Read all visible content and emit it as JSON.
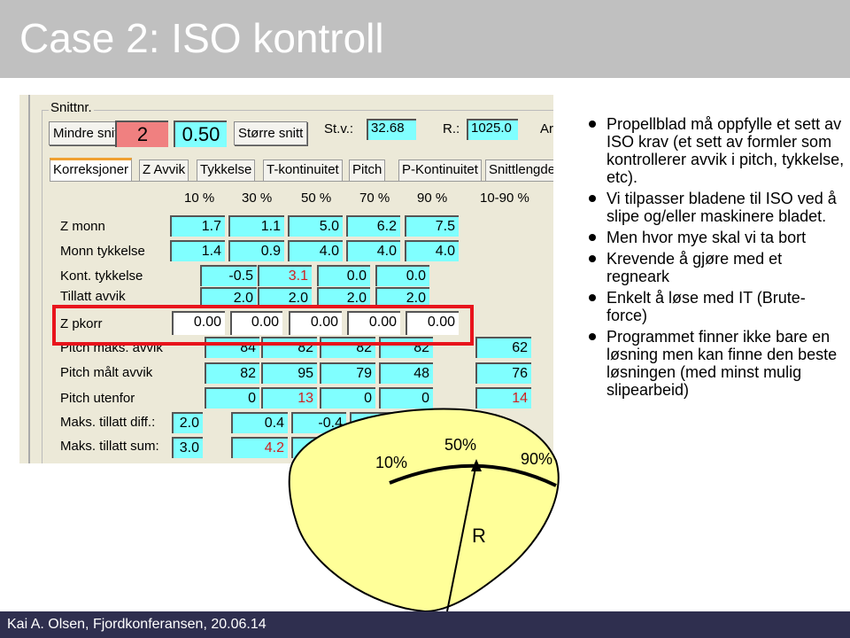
{
  "slide_title": "Case 2: ISO kontroll",
  "footer": "Kai A. Olsen, Fjordkonferansen, 20.06.14",
  "app": {
    "group_label": "Snittnr.",
    "smaller_btn": "Mindre snitt",
    "section_no": "2",
    "section_frac": "0.50",
    "larger_btn": "Større snitt",
    "stv_label": "St.v.:",
    "stv": "32.68",
    "r_label": "R.:",
    "r": "1025.0",
    "ar_label": "Arl",
    "tabs": [
      "Korreksjoner",
      "Z Avvik",
      "Tykkelse",
      "T-kontinuitet",
      "Pitch",
      "P-Kontinuitet",
      "Snittlengde"
    ],
    "columns": [
      "10 %",
      "30 %",
      "50 %",
      "70 %",
      "90 %",
      "10-90 %"
    ],
    "rows": [
      {
        "label": "Z monn",
        "values": [
          "1.7",
          "1.1",
          "5.0",
          "6.2",
          "7.5"
        ]
      },
      {
        "label": "Monn tykkelse",
        "values": [
          "1.4",
          "0.9",
          "4.0",
          "4.0",
          "4.0"
        ]
      },
      {
        "label": "Kont. tykkelse",
        "values": [
          "-0.5",
          "3.1",
          "0.0",
          "0.0"
        ]
      },
      {
        "label": "Tillatt avvik",
        "values": [
          "2.0",
          "2.0",
          "2.0",
          "2.0"
        ]
      },
      {
        "label": "Z pkorr",
        "values": [
          "0.00",
          "0.00",
          "0.00",
          "0.00",
          "0.00"
        ]
      },
      {
        "label": "Pitch maks. avvik",
        "values": [
          "84",
          "82",
          "82",
          "82",
          "62"
        ]
      },
      {
        "label": "Pitch målt avvik",
        "values": [
          "82",
          "95",
          "79",
          "48",
          "76"
        ]
      },
      {
        "label": "Pitch utenfor",
        "values": [
          "0",
          "13",
          "0",
          "0",
          "14"
        ]
      },
      {
        "label": "Maks. tillatt diff.:",
        "values": [
          "2.0",
          "0.4",
          "-0.4"
        ]
      },
      {
        "label": "Maks. tillatt sum:",
        "values": [
          "3.0",
          "4.2"
        ]
      }
    ],
    "highlight_color": "#80ffff",
    "warning_color": "#d02020"
  },
  "diagram": {
    "l10": "10%",
    "l50": "50%",
    "l90": "90%",
    "r": "R"
  },
  "bullets": [
    "Propellblad må oppfylle et sett av ISO krav (et sett av formler som kontrollerer avvik i pitch, tykkelse, etc).",
    "Vi tilpasser bladene til ISO ved å slipe og/eller maskinere bladet.",
    "Men hvor mye skal vi ta bort",
    "Krevende å gjøre med et regneark",
    "Enkelt å løse med IT (Brute-force)",
    "Programmet finner ikke bare en løsning men kan finne den beste løsningen (med minst mulig slipearbeid)"
  ]
}
